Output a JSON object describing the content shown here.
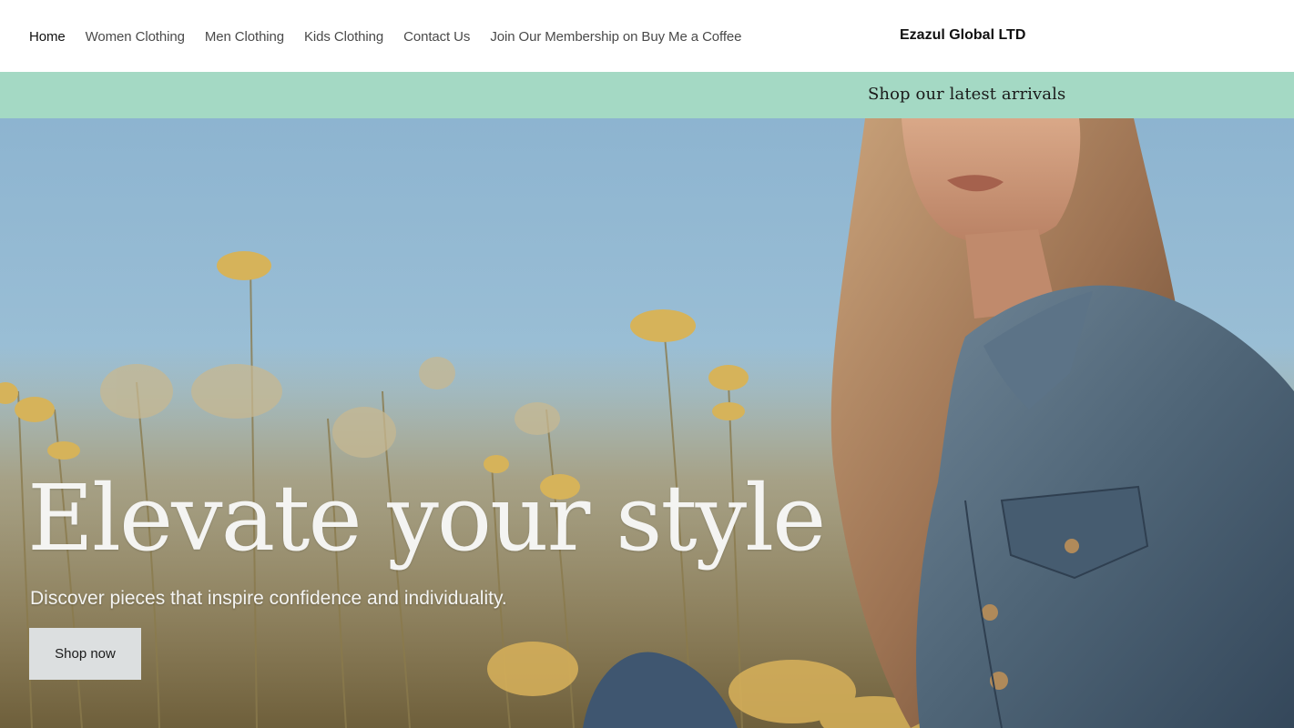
{
  "header": {
    "nav": [
      {
        "label": "Home",
        "active": true
      },
      {
        "label": "Women Clothing",
        "active": false
      },
      {
        "label": "Men Clothing",
        "active": false
      },
      {
        "label": "Kids Clothing",
        "active": false
      },
      {
        "label": "Contact Us",
        "active": false
      },
      {
        "label": "Join Our Membership on Buy Me a Coffee",
        "active": false
      }
    ],
    "brand": "Ezazul Global LTD"
  },
  "banner": {
    "text": "Shop our latest arrivals",
    "background_color": "#a4d9c4"
  },
  "hero": {
    "title": "Elevate your style",
    "subtitle": "Discover pieces that inspire confidence and individuality.",
    "button_label": "Shop now"
  }
}
